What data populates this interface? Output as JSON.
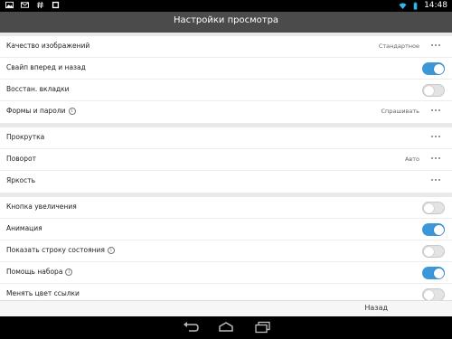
{
  "status_bar": {
    "time": "14:48",
    "left_icons": [
      "image-icon",
      "mail-icon",
      "hash-icon",
      "gallery-icon"
    ],
    "right_icons": [
      "wifi-icon",
      "battery-icon"
    ]
  },
  "title": "Настройки просмотра",
  "group1": [
    {
      "label": "Качество изображений",
      "value": "Стандартное",
      "control": "more"
    },
    {
      "label": "Свайп вперед и назад",
      "control": "toggle",
      "on": true
    },
    {
      "label": "Восстан. вкладки",
      "control": "toggle",
      "on": false
    },
    {
      "label": "Формы и пароли",
      "info": true,
      "value": "Спрашивать",
      "control": "more"
    }
  ],
  "group2": [
    {
      "label": "Прокрутка",
      "control": "more"
    },
    {
      "label": "Поворот",
      "value": "Авто",
      "control": "more"
    },
    {
      "label": "Яркость",
      "control": "more"
    }
  ],
  "group3": [
    {
      "label": "Кнопка увеличения",
      "control": "toggle",
      "on": false
    },
    {
      "label": "Анимация",
      "control": "toggle",
      "on": true
    },
    {
      "label": "Показать строку состояния",
      "info": true,
      "control": "toggle",
      "on": false
    },
    {
      "label": "Помощь набора",
      "info": true,
      "control": "toggle",
      "on": true
    },
    {
      "label": "Менять цвет ссылки",
      "control": "toggle",
      "on": false
    }
  ],
  "info_glyph": "i",
  "footer": {
    "back_label": "Назад"
  },
  "colors": {
    "accent": "#3c96da",
    "title_bar": "#4b4b4b",
    "background": "#e9e9e9"
  },
  "nav_icons": [
    "back-icon",
    "home-icon",
    "recent-apps-icon"
  ]
}
